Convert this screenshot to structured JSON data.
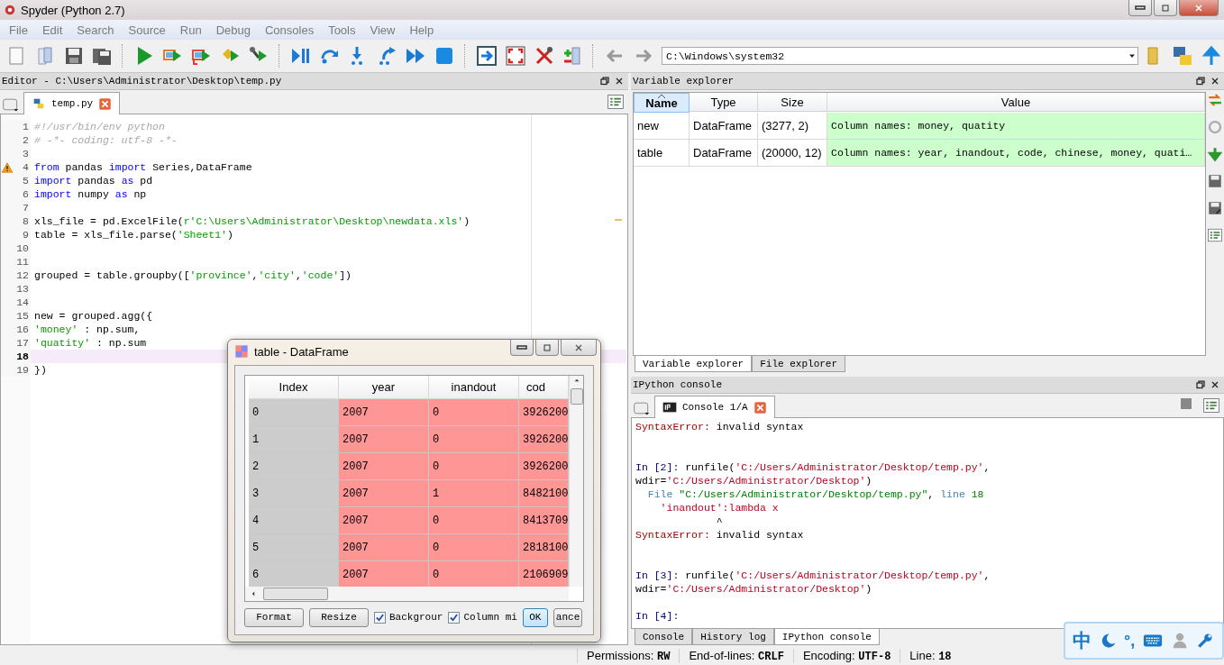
{
  "window": {
    "title": "Spyder (Python 2.7)"
  },
  "menu": [
    "File",
    "Edit",
    "Search",
    "Source",
    "Run",
    "Debug",
    "Consoles",
    "Tools",
    "View",
    "Help"
  ],
  "toolbar": {
    "path": "C:\\Windows\\system32"
  },
  "editor": {
    "title": "Editor - C:\\Users\\Administrator\\Desktop\\temp.py",
    "tabs": [
      {
        "label": "temp.py",
        "selected": true
      }
    ],
    "lines": [
      {
        "number": "1",
        "warning": false,
        "current": false,
        "tokens": [
          {
            "kind": "comment",
            "text": "#!/usr/bin/env python"
          }
        ]
      },
      {
        "number": "2",
        "warning": false,
        "current": false,
        "tokens": [
          {
            "kind": "comment",
            "text": "# -*- coding: utf-8 -*-"
          }
        ]
      },
      {
        "number": "3",
        "warning": false,
        "current": false
      },
      {
        "number": "4",
        "warning": true,
        "current": false,
        "tokens": [
          {
            "kind": "keyword",
            "text": "from"
          },
          {
            "kind": "plain",
            "text": " pandas "
          },
          {
            "kind": "keyword",
            "text": "import"
          },
          {
            "kind": "plain",
            "text": " Series,DataFrame"
          }
        ]
      },
      {
        "number": "5",
        "warning": false,
        "current": false,
        "tokens": [
          {
            "kind": "keyword",
            "text": "import"
          },
          {
            "kind": "plain",
            "text": " pandas "
          },
          {
            "kind": "keyword",
            "text": "as"
          },
          {
            "kind": "plain",
            "text": " pd"
          }
        ]
      },
      {
        "number": "6",
        "warning": false,
        "current": false,
        "tokens": [
          {
            "kind": "keyword",
            "text": "import"
          },
          {
            "kind": "plain",
            "text": " numpy "
          },
          {
            "kind": "keyword",
            "text": "as"
          },
          {
            "kind": "plain",
            "text": " np"
          }
        ]
      },
      {
        "number": "7",
        "warning": false,
        "current": false
      },
      {
        "number": "8",
        "warning": false,
        "current": false,
        "tokens": [
          {
            "kind": "plain",
            "text": "xls_file = pd.ExcelFile("
          },
          {
            "kind": "string",
            "text": "r'C:\\Users\\Administrator\\Desktop\\newdata.xls'"
          },
          {
            "kind": "plain",
            "text": ")"
          }
        ]
      },
      {
        "number": "9",
        "warning": false,
        "current": false,
        "tokens": [
          {
            "kind": "plain",
            "text": "table = xls_file.parse("
          },
          {
            "kind": "string",
            "text": "'Sheet1'"
          },
          {
            "kind": "plain",
            "text": ")"
          }
        ]
      },
      {
        "number": "10",
        "warning": false,
        "current": false
      },
      {
        "number": "11",
        "warning": false,
        "current": false
      },
      {
        "number": "12",
        "warning": false,
        "current": false,
        "tokens": [
          {
            "kind": "plain",
            "text": "grouped = table.groupby(["
          },
          {
            "kind": "string",
            "text": "'province'"
          },
          {
            "kind": "plain",
            "text": ","
          },
          {
            "kind": "string",
            "text": "'city'"
          },
          {
            "kind": "plain",
            "text": ","
          },
          {
            "kind": "string",
            "text": "'code'"
          },
          {
            "kind": "plain",
            "text": "])"
          }
        ]
      },
      {
        "number": "13",
        "warning": false,
        "current": false
      },
      {
        "number": "14",
        "warning": false,
        "current": false
      },
      {
        "number": "15",
        "warning": false,
        "current": false,
        "tokens": [
          {
            "kind": "plain",
            "text": "new = grouped.agg({"
          }
        ]
      },
      {
        "number": "16",
        "warning": false,
        "current": false,
        "tokens": [
          {
            "kind": "string",
            "text": "'money'"
          },
          {
            "kind": "plain",
            "text": " : np.sum,"
          }
        ]
      },
      {
        "number": "17",
        "warning": false,
        "current": false,
        "tokens": [
          {
            "kind": "string",
            "text": "'quatity'"
          },
          {
            "kind": "plain",
            "text": " : np.sum"
          }
        ]
      },
      {
        "number": "18",
        "warning": false,
        "current": true
      },
      {
        "number": "19",
        "warning": false,
        "current": false,
        "tokens": [
          {
            "kind": "plain",
            "text": "})"
          }
        ]
      }
    ]
  },
  "variable_explorer": {
    "title": "Variable explorer",
    "columns": [
      {
        "label": "Name",
        "sorted": true
      },
      {
        "label": "Type",
        "sorted": false
      },
      {
        "label": "Size",
        "sorted": false
      },
      {
        "label": "Value",
        "sorted": false
      }
    ],
    "rows": [
      {
        "name": "new",
        "type": "DataFrame",
        "size": "(3277, 2)",
        "value": "Column names: money, quatity"
      },
      {
        "name": "table",
        "type": "DataFrame",
        "size": "(20000, 12)",
        "value": "Column names: year, inandout, code, chinese, money, quati…"
      }
    ],
    "tabs": [
      {
        "label": "Variable explorer",
        "selected": true
      },
      {
        "label": "File explorer",
        "selected": false
      }
    ]
  },
  "console": {
    "title": "IPython console",
    "tabs": [
      {
        "label": "Console 1/A",
        "selected": true
      }
    ],
    "lines": [
      {
        "kind": "text",
        "tokens": [
          {
            "kind": "error",
            "text": "SyntaxError:"
          },
          {
            "kind": "plain",
            "text": " invalid syntax"
          }
        ]
      },
      {
        "kind": "blank"
      },
      {
        "kind": "blank"
      },
      {
        "kind": "text",
        "tokens": [
          {
            "kind": "prompt",
            "text": "In [2]:"
          },
          {
            "kind": "plain",
            "text": " runfile("
          },
          {
            "kind": "string",
            "text": "'C:/Users/Administrator/Desktop/temp.py'"
          },
          {
            "kind": "plain",
            "text": ","
          }
        ]
      },
      {
        "kind": "text",
        "tokens": [
          {
            "kind": "plain",
            "text": "wdir="
          },
          {
            "kind": "string",
            "text": "'C:/Users/Administrator/Desktop'"
          },
          {
            "kind": "plain",
            "text": ")"
          }
        ]
      },
      {
        "kind": "text",
        "tokens": [
          {
            "kind": "info",
            "text": "  File "
          },
          {
            "kind": "path",
            "text": "\"C:/Users/Administrator/Desktop/temp.py\""
          },
          {
            "kind": "plain",
            "text": ", "
          },
          {
            "kind": "info",
            "text": "line "
          },
          {
            "kind": "path",
            "text": "18"
          }
        ]
      },
      {
        "kind": "text",
        "tokens": [
          {
            "kind": "string",
            "text": "    'inandout':lambda x"
          }
        ]
      },
      {
        "kind": "text",
        "tokens": [
          {
            "kind": "plain",
            "text": "             ^"
          }
        ]
      },
      {
        "kind": "text",
        "tokens": [
          {
            "kind": "error",
            "text": "SyntaxError:"
          },
          {
            "kind": "plain",
            "text": " invalid syntax"
          }
        ]
      },
      {
        "kind": "blank"
      },
      {
        "kind": "blank"
      },
      {
        "kind": "text",
        "tokens": [
          {
            "kind": "prompt",
            "text": "In [3]:"
          },
          {
            "kind": "plain",
            "text": " runfile("
          },
          {
            "kind": "string",
            "text": "'C:/Users/Administrator/Desktop/temp.py'"
          },
          {
            "kind": "plain",
            "text": ","
          }
        ]
      },
      {
        "kind": "text",
        "tokens": [
          {
            "kind": "plain",
            "text": "wdir="
          },
          {
            "kind": "string",
            "text": "'C:/Users/Administrator/Desktop'"
          },
          {
            "kind": "plain",
            "text": ")"
          }
        ]
      },
      {
        "kind": "blank"
      },
      {
        "kind": "text",
        "tokens": [
          {
            "kind": "prompt",
            "text": "In [4]:"
          }
        ]
      }
    ],
    "bottom_tabs": [
      {
        "label": "Console",
        "selected": false
      },
      {
        "label": "History log",
        "selected": false
      },
      {
        "label": "IPython console",
        "selected": true
      }
    ]
  },
  "status_bar": [
    {
      "label": "Permissions:",
      "value": "RW"
    },
    {
      "label": "End-of-lines:",
      "value": "CRLF"
    },
    {
      "label": "Encoding:",
      "value": "UTF-8"
    },
    {
      "label": "Line:",
      "value": "18"
    }
  ],
  "dataframe_dialog": {
    "title": "table - DataFrame",
    "columns": [
      "Index",
      "year",
      "inandout",
      "cod"
    ],
    "rows": [
      [
        "0",
        "2007",
        "0",
        "3926200"
      ],
      [
        "1",
        "2007",
        "0",
        "3926200"
      ],
      [
        "2",
        "2007",
        "0",
        "3926200"
      ],
      [
        "3",
        "2007",
        "1",
        "8482100"
      ],
      [
        "4",
        "2007",
        "0",
        "8413709"
      ],
      [
        "5",
        "2007",
        "0",
        "2818100"
      ],
      [
        "6",
        "2007",
        "0",
        "2106909"
      ]
    ],
    "controls": [
      {
        "kind": "button",
        "label": "Format",
        "default": false
      },
      {
        "kind": "button",
        "label": "Resize",
        "default": false
      },
      {
        "kind": "checkbox",
        "label": "Backgrour",
        "checked": true
      },
      {
        "kind": "checkbox",
        "label": "Column mi",
        "checked": true
      },
      {
        "kind": "button",
        "label": "OK",
        "default": true
      },
      {
        "kind": "button",
        "label": "ance",
        "default": false
      }
    ]
  },
  "ime_bar": {
    "language": "中",
    "punctuation": "°,"
  }
}
